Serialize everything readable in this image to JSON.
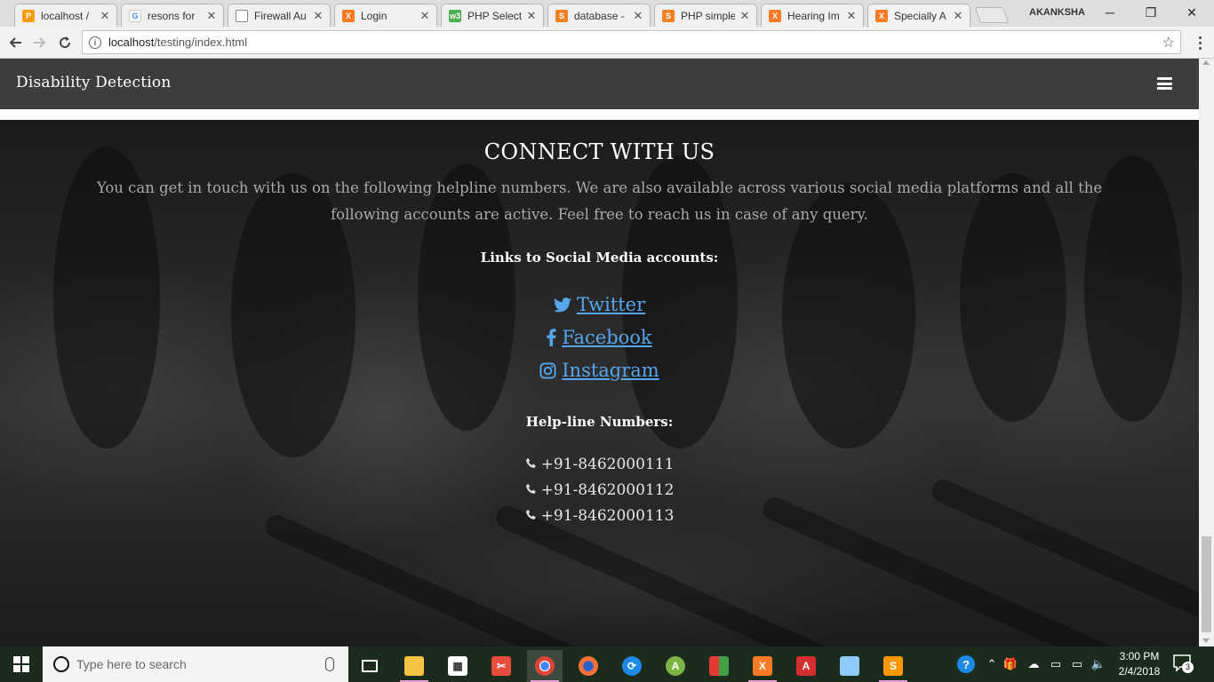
{
  "browser": {
    "tabs": [
      {
        "label": "localhost /",
        "favicon": "phpmyadmin-icon",
        "color": "#f89c0e"
      },
      {
        "label": "resons for",
        "favicon": "google-icon",
        "color": "#4285f4"
      },
      {
        "label": "Firewall Au",
        "favicon": "page-icon",
        "color": "#888888"
      },
      {
        "label": "Login",
        "favicon": "xampp-icon",
        "color": "#fb7a24"
      },
      {
        "label": "PHP Select",
        "favicon": "w3-icon",
        "color": "#4caf50"
      },
      {
        "label": "database -",
        "favicon": "stackoverflow-icon",
        "color": "#f48024"
      },
      {
        "label": "PHP simple",
        "favicon": "stackoverflow-icon",
        "color": "#f48024"
      },
      {
        "label": "Hearing Im",
        "favicon": "xampp-icon",
        "color": "#fb7a24"
      },
      {
        "label": "Specially A",
        "favicon": "xampp-icon",
        "color": "#fb7a24"
      }
    ],
    "profile_name": "AKANKSHA",
    "url_host": "localhost",
    "url_path": "/testing/index.html"
  },
  "page": {
    "brand": "Disability Detection",
    "heading": "CONNECT WITH US",
    "intro": "You can get in touch with us on the following helpline numbers. We are also available across various social media platforms and all the following accounts are active. Feel free to reach us in case of any query.",
    "links_title": "Links to Social Media accounts:",
    "social": [
      {
        "label": "Twitter",
        "icon": "twitter-icon"
      },
      {
        "label": "Facebook",
        "icon": "facebook-icon"
      },
      {
        "label": "Instagram",
        "icon": "instagram-icon"
      }
    ],
    "help_title": "Help-line Numbers:",
    "phones": [
      "+91-8462000111",
      "+91-8462000112",
      "+91-8462000113"
    ],
    "link_color": "#56a6ee",
    "navbar_color": "#3d3d3d"
  },
  "taskbar": {
    "search_placeholder": "Type here to search",
    "time": "3:00 PM",
    "date": "2/4/2018",
    "notification_count": "3"
  }
}
